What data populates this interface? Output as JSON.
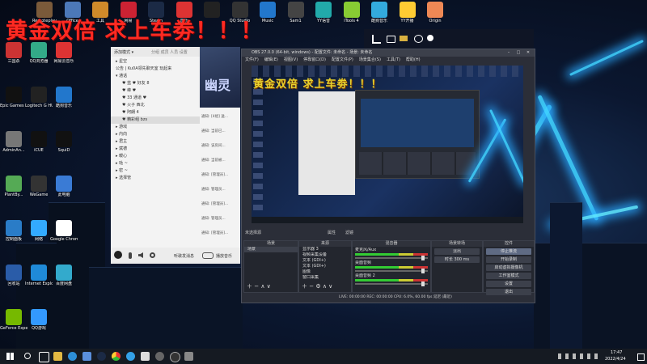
{
  "overlay": {
    "title": "黄金双倍  求上车劵！！！",
    "preview_title": "黄金双倍  求上车劵！！！"
  },
  "top_icons": [
    "Remoteplay",
    "Office",
    "工具",
    "网易",
    "Steam",
    "音乐",
    "",
    "QQ Studio",
    "Music",
    "Sam1",
    "YY语音",
    "iTools 4",
    "酷狗音乐",
    "YY开播",
    "Origin"
  ],
  "desktop_icons": [
    "三国杀",
    "QQ浏览器",
    "网易云音乐",
    "Epic Games Launcher",
    "Logitech G HUB",
    "酷狗音乐",
    "AdminAn...",
    "iCUE",
    "SquiD",
    "PlantBy...",
    "WeGame",
    "此电脑",
    "控制面板",
    "网络",
    "Google Chrome",
    "回收站",
    "Internet Explorer",
    "百度网盘",
    "GeForce Experience",
    "QQ游戏"
  ],
  "chat": {
    "header_left": "添加模式 ▾",
    "header_right": "分组  成员 人员 设置",
    "groups": [
      {
        "label": "▸ 星空"
      },
      {
        "label": "公告 | Ku0A领先聊天室 玩起来"
      },
      {
        "label": "▾ 通话"
      },
      {
        "label": "♥ 蓝 ♥ 好友 8"
      },
      {
        "label": "♥ 峰 ♥"
      },
      {
        "label": "♥ 33 通道 ♥"
      },
      {
        "label": "♥ 火子 西北"
      },
      {
        "label": "♥ 阿朗 4"
      },
      {
        "label": "♥ 精彩组 bzs"
      },
      {
        "label": "▸ 游戏"
      },
      {
        "label": "▸ 内向"
      },
      {
        "label": "▸ 君主"
      },
      {
        "label": "▸ 斌德"
      },
      {
        "label": "▸ 暖心"
      },
      {
        "label": "▸ 哒 ~"
      },
      {
        "label": "▸ 密 ~"
      },
      {
        "label": "▸ 选择管"
      }
    ],
    "messages": [
      "通知: [4组] 送...",
      "通知: 当前已...",
      "通知: 该房间...",
      "通知: 当前被...",
      "通知: [管理员]...",
      "通知: 管理员...",
      "通知: [管理员]...",
      "通知: 管理员...",
      "通知: [管理员]..."
    ],
    "footer_left": "听歌发消息",
    "footer_right": "播放音乐"
  },
  "obs": {
    "title": "OBS 27.0.0 (64-bit, windows) - 配置文件: 未命名 - 场景: 未命名",
    "menu": [
      "文件(F)",
      "编辑(E)",
      "视图(V)",
      "停靠窗口(D)",
      "配置文件(P)",
      "场景集合(S)",
      "工具(T)",
      "帮助(H)"
    ],
    "no_source": "未选择源",
    "prop_btn": "属性",
    "filter_btn": "滤镜",
    "docks": {
      "scenes": {
        "header": "场景",
        "items": [
          "场景"
        ]
      },
      "sources": {
        "header": "来源",
        "items": [
          "显示器 3",
          "视频采集设备",
          "文本 (GDI+)",
          "文本 (GDI+)",
          "图像",
          "窗口采集"
        ]
      },
      "mixer": {
        "header": "混音器",
        "items": [
          "麦克风/Aux",
          "桌面音频",
          "桌面音频 2"
        ]
      },
      "transitions": {
        "header": "场景转场",
        "items": [
          "淡出",
          "时长 300 ms"
        ]
      },
      "controls": {
        "header": "控件",
        "items": [
          "停止推流",
          "开始录制",
          "启动虚拟摄像机",
          "工作室模式",
          "设置",
          "退出"
        ]
      }
    },
    "status": "LIVE: 00:00:00   REC: 00:00:00   CPU: 6.0%, 60.00 fps   延迟 (最近)"
  },
  "taskbar": {
    "time": "17:47",
    "date": "2022/4/24"
  }
}
